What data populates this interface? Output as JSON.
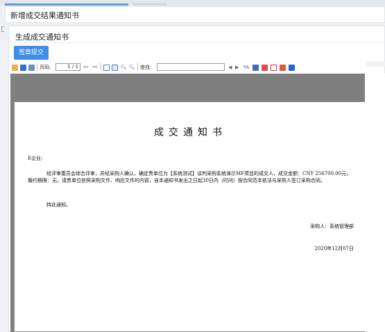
{
  "page": {
    "title": "新增成交结果通知书"
  },
  "panel": {
    "title": "生成成交通知书",
    "submit_label": "签章提交"
  },
  "toolbar": {
    "page_label": "页码:",
    "page_value": "1 / 1",
    "search_label": "查找:",
    "search_value": ""
  },
  "document": {
    "title": "成交通知书",
    "recipient": "E企业:",
    "body": "经评审委员会综合评审，并经采购人确认，确定贵单位为【系统测试】谈判采购系统演示MF项目的成交人，成交金额：CNY 256700.00元，履约期限：无。请贵单位依照采购文件、响应文件的内容，自本通知书发出之日起30日内（时间）按合同范本依法与采购人签订采购合同。",
    "notice": "特此通知。",
    "buyer": "采购人：系统管理部",
    "date": "2020年12月07日"
  },
  "icon_colors": {
    "save": "#2b6fd1",
    "print": "#3b7dd8",
    "pdf": "#d62b2b",
    "highlight": "#e04a4a"
  }
}
